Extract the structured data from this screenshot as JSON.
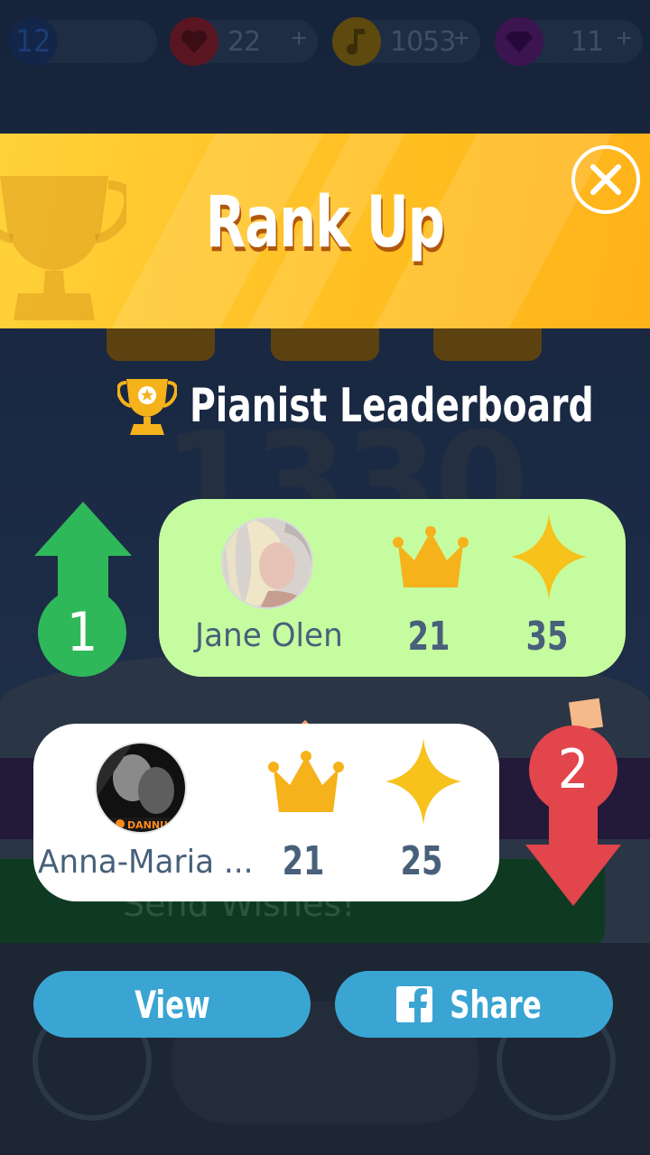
{
  "status_bar": {
    "level": "12",
    "lives": "22",
    "notes": "1053",
    "gems": "11"
  },
  "background": {
    "score": "1330",
    "wishes_label": "Send Wishes!"
  },
  "dialog": {
    "title": "Rank Up",
    "leaderboard_title": "Pianist Leaderboard"
  },
  "ranks": [
    {
      "rank": "1",
      "name": "Jane Olen",
      "crowns": "21",
      "stars": "35",
      "direction": "up"
    },
    {
      "rank": "2",
      "name": "Anna-Maria ...",
      "crowns": "21",
      "stars": "25",
      "direction": "down",
      "avatar_text": "DANNU"
    }
  ],
  "buttons": {
    "view": "View",
    "share": "Share"
  },
  "colors": {
    "banner": "#ffc52a",
    "rank_up": "#2fb85a",
    "rank_down": "#e2454c",
    "card_highlight": "#c6fca0",
    "button": "#3aa5d3",
    "stat_text": "#48607a"
  }
}
